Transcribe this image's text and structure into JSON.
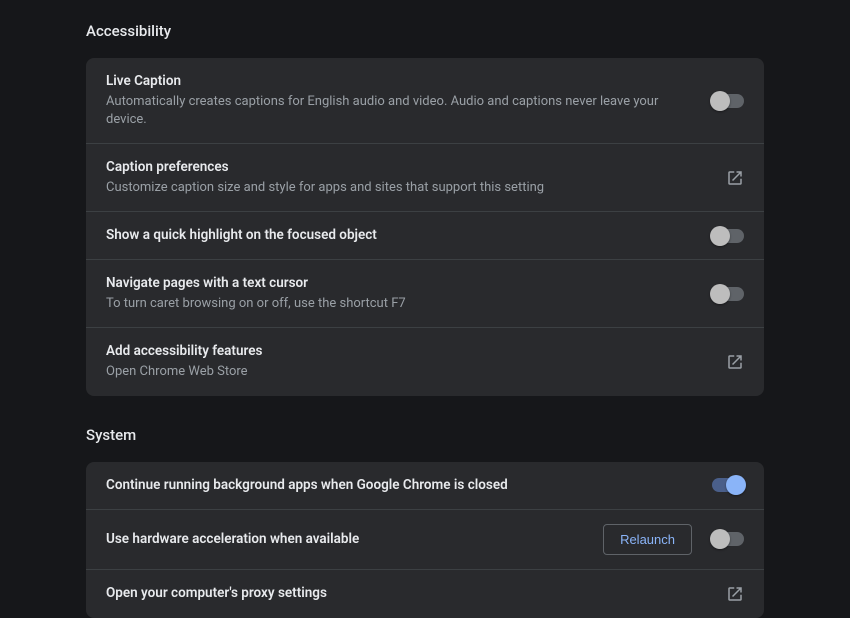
{
  "accessibility": {
    "heading": "Accessibility",
    "rows": {
      "liveCaption": {
        "title": "Live Caption",
        "sub": "Automatically creates captions for English audio and video. Audio and captions never leave your device."
      },
      "captionPrefs": {
        "title": "Caption preferences",
        "sub": "Customize caption size and style for apps and sites that support this setting"
      },
      "quickHighlight": {
        "title": "Show a quick highlight on the focused object"
      },
      "caretBrowsing": {
        "title": "Navigate pages with a text cursor",
        "sub": "To turn caret browsing on or off, use the shortcut F7"
      },
      "addFeatures": {
        "title": "Add accessibility features",
        "sub": "Open Chrome Web Store"
      }
    }
  },
  "system": {
    "heading": "System",
    "rows": {
      "backgroundApps": {
        "title": "Continue running background apps when Google Chrome is closed"
      },
      "hwAccel": {
        "title": "Use hardware acceleration when available",
        "relaunch": "Relaunch"
      },
      "proxy": {
        "title": "Open your computer's proxy settings"
      }
    }
  }
}
